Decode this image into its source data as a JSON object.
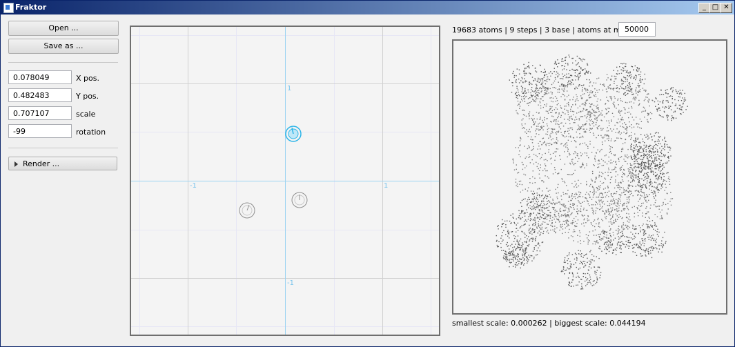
{
  "window": {
    "title": "Fraktor",
    "min_label": "_",
    "max_label": "□",
    "close_label": "✕"
  },
  "sidebar": {
    "open_label": "Open ...",
    "save_label": "Save as ...",
    "fields": [
      {
        "value": "0.078049",
        "label": "X pos."
      },
      {
        "value": "0.482483",
        "label": "Y pos."
      },
      {
        "value": "0.707107",
        "label": "scale"
      },
      {
        "value": "-99",
        "label": "rotation"
      }
    ],
    "render_label": "Render ..."
  },
  "plane": {
    "axis_labels": {
      "top": "1",
      "bottom": "-1",
      "left": "-1",
      "right": "1"
    },
    "accent_color": "#2ab4e8"
  },
  "preview": {
    "info_text": "19683 atoms | 9 steps | 3 base | atoms at most:",
    "max_atoms": "50000",
    "scale_info": "smallest scale: 0.000262 | biggest scale: 0.044194"
  }
}
